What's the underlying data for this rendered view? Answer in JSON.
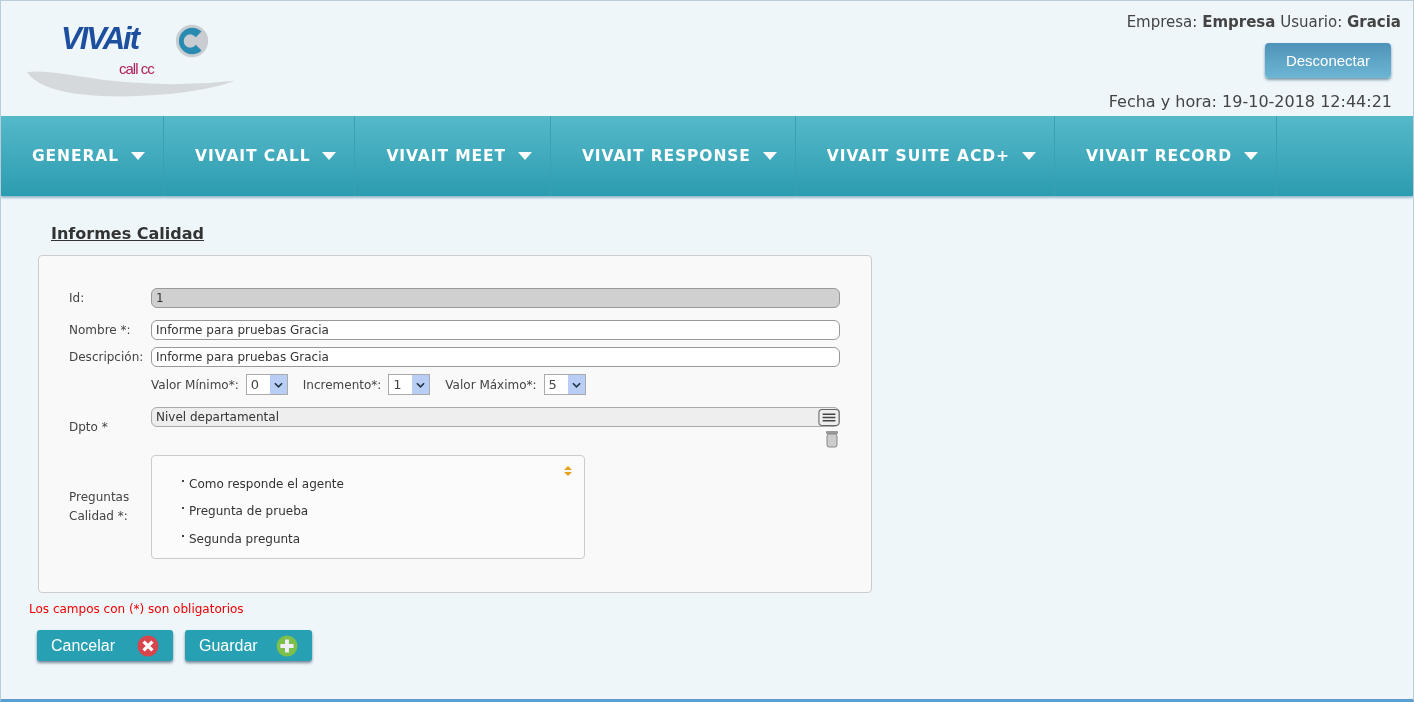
{
  "logo": {
    "brand": "VIVAit",
    "tagline": "call cc"
  },
  "header": {
    "company_label": "Empresa:",
    "company": "Empresa",
    "user_label": "Usuario:",
    "user": "Gracia",
    "logout_button": "Desconectar",
    "datetime": "Fecha y hora: 19-10-2018 12:44:21"
  },
  "nav": [
    {
      "label": "GENERAL"
    },
    {
      "label": "VIVAIT CALL"
    },
    {
      "label": "VIVAIT MEET"
    },
    {
      "label": "VIVAIT RESPONSE"
    },
    {
      "label": "VIVAIT SUITE ACD+"
    },
    {
      "label": "VIVAIT RECORD"
    }
  ],
  "page_title": "Informes Calidad",
  "form": {
    "id": {
      "label": "Id:",
      "value": "1",
      "disabled": true
    },
    "name": {
      "label": "Nombre *:",
      "value": "Informe para pruebas Gracia",
      "disabled": false
    },
    "description": {
      "label": "Descripción:",
      "value": "Informe para pruebas Gracia",
      "disabled": false
    },
    "selects": [
      {
        "label": "Valor Mínimo*:",
        "value": "0"
      },
      {
        "label": "Incremento*:",
        "value": "1"
      },
      {
        "label": "Valor Máximo*:",
        "value": "5"
      }
    ],
    "department": {
      "label": "Dpto *",
      "value": "Nivel departamental"
    },
    "questions": {
      "label": "Preguntas Calidad *:",
      "items": [
        "Como responde el agente",
        "Pregunta de prueba",
        "Segunda pregunta"
      ]
    }
  },
  "required_note": "Los campos con (*) son obligatorios",
  "buttons": [
    {
      "label": "Cancelar",
      "kind": "cancel"
    },
    {
      "label": "Guardar",
      "kind": "save"
    }
  ]
}
